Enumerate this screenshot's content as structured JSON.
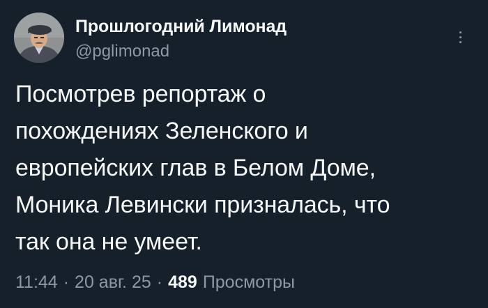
{
  "author": {
    "name": "Прошлогодний Лимонад",
    "handle": "@pglimonad"
  },
  "tweet": {
    "lines": [
      "Посмотрев репортаж о",
      "похождениях Зеленского и",
      "европейских глав в Белом Доме,",
      "Моника Левински призналась, что",
      "так она не умеет."
    ],
    "time": "11:44",
    "date": "20 авг. 25",
    "separator": "·",
    "views_count": "489",
    "views_label": "Просмотры"
  },
  "icons": {
    "more": "more-options-icon",
    "avatar": "avatar-image"
  },
  "colors": {
    "background": "#15202b",
    "text_primary": "#f7f9f9",
    "text_secondary": "#8b98a5"
  }
}
